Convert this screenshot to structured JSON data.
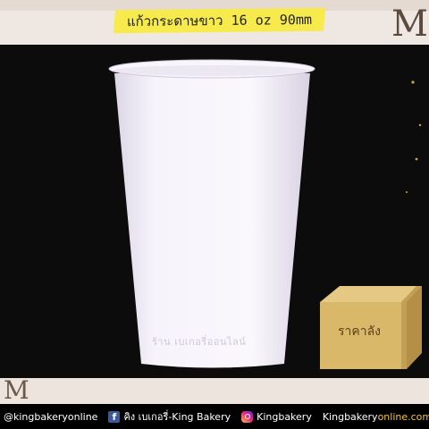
{
  "title": "แก้วกระดาษขาว 16 oz 90mm",
  "price_box_label": "ราคาลัง",
  "cup_print": "ร้าน เบเกอรี่ออนไลน์",
  "footer": {
    "facebook_handle": "@kingbakeryonline",
    "facebook_page": "คิง เบเกอรี่-King Bakery",
    "instagram": "Kingbakery",
    "website_main": "Kingbakery",
    "website_suffix": "online.com"
  },
  "colors": {
    "background": "#000000",
    "banner": "#f7ea4d",
    "cup": "#f6f3fb",
    "box": "#d9b86a",
    "accent_text": "#f4c430"
  }
}
